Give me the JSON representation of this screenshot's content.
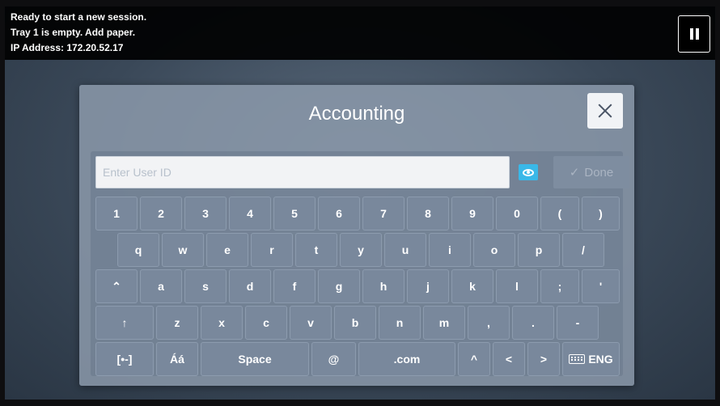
{
  "status": {
    "lines": [
      "Ready to start a new session.",
      "Tray 1 is empty.  Add paper.",
      "IP Address: 172.20.52.17"
    ]
  },
  "dialog": {
    "title": "Accounting",
    "input_placeholder": "Enter User ID",
    "input_value": "",
    "done_label": "Done"
  },
  "keyboard": {
    "row1": [
      "1",
      "2",
      "3",
      "4",
      "5",
      "6",
      "7",
      "8",
      "9",
      "0",
      "(",
      ")"
    ],
    "row2": [
      "q",
      "w",
      "e",
      "r",
      "t",
      "y",
      "u",
      "i",
      "o",
      "p",
      "/"
    ],
    "row3": [
      "⌃",
      "a",
      "s",
      "d",
      "f",
      "g",
      "h",
      "j",
      "k",
      "l",
      ";",
      "'"
    ],
    "row4": [
      "↑",
      "z",
      "x",
      "c",
      "v",
      "b",
      "n",
      "m",
      ",",
      ".",
      "-"
    ],
    "row5": {
      "symbols": "[•-]",
      "accents": "Áá",
      "space": "Space",
      "at": "@",
      "dotcom": ".com",
      "caret": "^",
      "left": "<",
      "right": ">",
      "language": "ENG"
    }
  }
}
